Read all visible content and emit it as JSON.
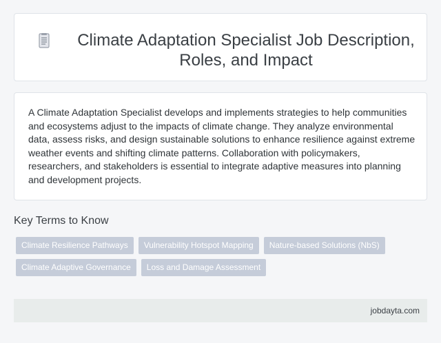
{
  "header": {
    "icon": "document-icon",
    "title": "Climate Adaptation Specialist Job Description, Roles, and Impact"
  },
  "description": {
    "text": "A Climate Adaptation Specialist develops and implements strategies to help communities and ecosystems adjust to the impacts of climate change. They analyze environmental data, assess risks, and design sustainable solutions to enhance resilience against extreme weather events and shifting climate patterns. Collaboration with policymakers, researchers, and stakeholders is essential to integrate adaptive measures into planning and development projects."
  },
  "key_terms": {
    "heading": "Key Terms to Know",
    "tags": [
      "Climate Resilience Pathways",
      "Vulnerability Hotspot Mapping",
      "Nature-based Solutions (NbS)",
      "Climate Adaptive Governance",
      "Loss and Damage Assessment"
    ]
  },
  "footer": {
    "site": "jobdayta.com"
  },
  "colors": {
    "tag_background": "#c5ccd9",
    "footer_background": "#e8eceb",
    "page_background": "#f5f6f8"
  }
}
